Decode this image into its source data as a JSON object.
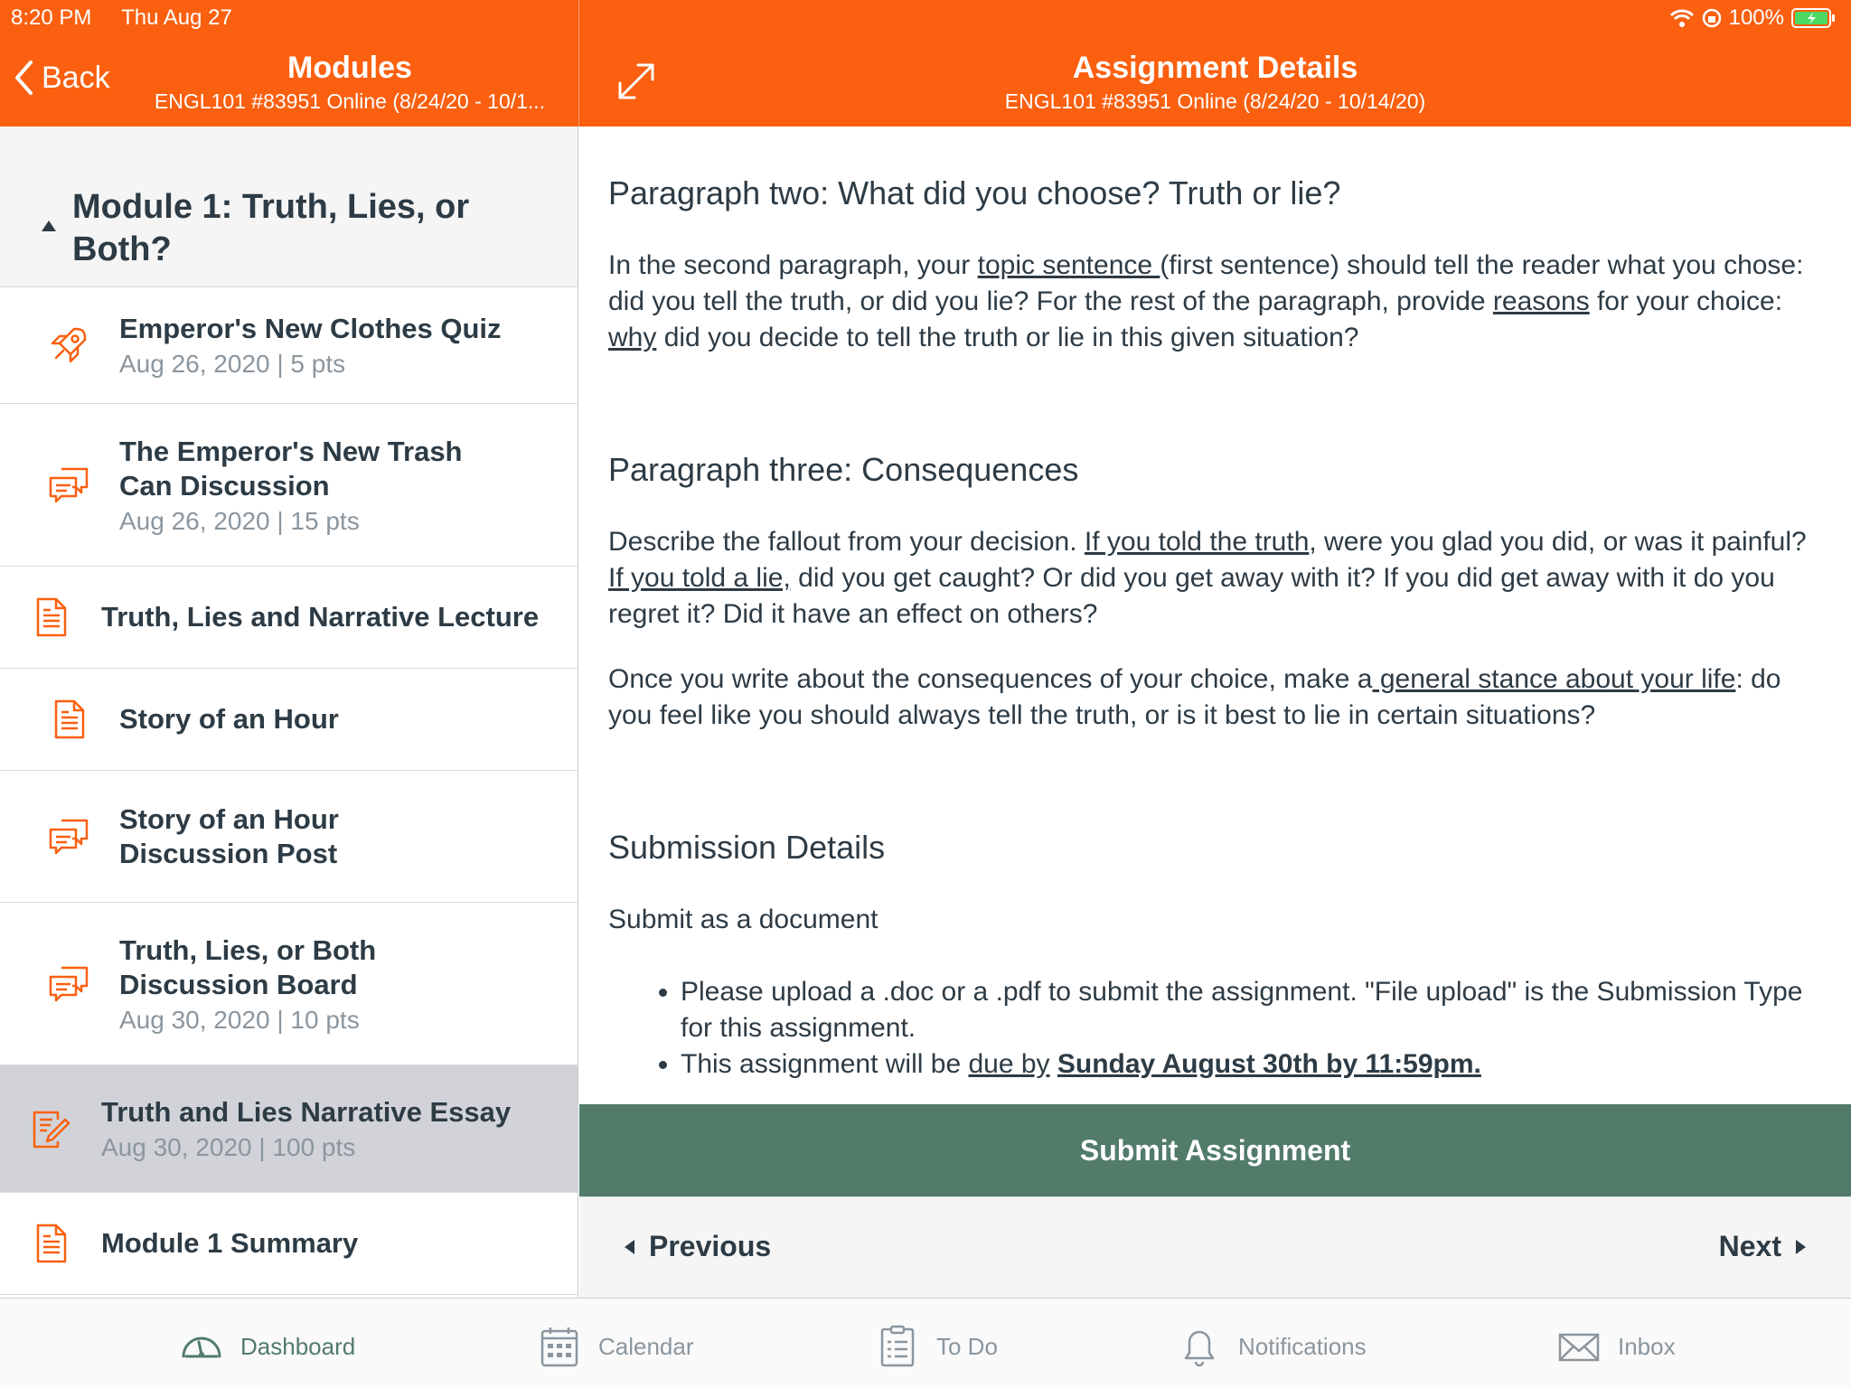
{
  "status_bar": {
    "time": "8:20 PM",
    "date": "Thu Aug 27",
    "battery": "100%"
  },
  "left_header": {
    "back_label": "Back",
    "title": "Modules",
    "subtitle": "ENGL101 #83951 Online (8/24/20 - 10/1..."
  },
  "right_header": {
    "title": "Assignment Details",
    "subtitle": "ENGL101 #83951 Online (8/24/20 - 10/14/20)"
  },
  "module": {
    "name": "Module 1: Truth, Lies, or Both?",
    "items": [
      {
        "icon": "rocket-icon",
        "title": "Emperor's New Clothes Quiz",
        "meta": "Aug 26, 2020 | 5 pts"
      },
      {
        "icon": "discussion-icon",
        "title": "The Emperor's New Trash Can Discussion",
        "meta": "Aug 26, 2020 | 15 pts"
      },
      {
        "icon": "page-icon",
        "title": "Truth, Lies and Narrative Lecture",
        "meta": ""
      },
      {
        "icon": "page-icon",
        "title": "Story of an Hour",
        "meta": ""
      },
      {
        "icon": "discussion-icon",
        "title": "Story of an Hour Discussion Post",
        "meta": ""
      },
      {
        "icon": "discussion-icon",
        "title": "Truth, Lies, or Both Discussion Board",
        "meta": "Aug 30, 2020 | 10 pts"
      },
      {
        "icon": "assignment-icon",
        "title": "Truth and Lies Narrative Essay",
        "meta": "Aug 30, 2020 | 100 pts",
        "selected": true
      },
      {
        "icon": "page-icon",
        "title": "Module 1 Summary",
        "meta": ""
      }
    ]
  },
  "content": {
    "p2_heading": "Paragraph two: What did you choose? Truth or lie?",
    "p2_a": "In the second paragraph, your ",
    "p2_link1": "topic sentence ",
    "p2_b": "(first sentence) should tell the reader what you chose: did you tell the truth, or did you lie? For the rest of the paragraph, provide ",
    "p2_link2": "reasons",
    "p2_c": " for your choice: ",
    "p2_link3": "why",
    "p2_d": " did you decide to tell the truth or lie in this given situation?",
    "p3_heading": "Paragraph three: Consequences",
    "p3_a": "Describe the fallout from your decision. ",
    "p3_link1": "If you told the truth",
    "p3_b": ", were you glad you did, or was it painful? ",
    "p3_link2": "If you told a lie,",
    "p3_c": " did you get caught? Or did you get away with it? If you did get away with it do you regret it? Did it have an effect on others?",
    "p4_a": "Once you write about the consequences of your choice, make a",
    "p4_link1": " general stance about your life",
    "p4_b": ": do you feel like you should always tell the truth, or is it best to lie in certain situations?",
    "sub_heading": "Submission Details",
    "sub_text": "Submit as a document",
    "bullet1": "Please upload a .doc or a .pdf to submit the assignment. \"File upload\" is the Submission Type for this assignment.",
    "bullet2_a": "This assignment will be ",
    "bullet2_link": "due by",
    "bullet2_b": " ",
    "bullet2_bold": "Sunday August 30th by 11:59pm."
  },
  "actions": {
    "submit_label": "Submit Assignment",
    "previous_label": "Previous",
    "next_label": "Next"
  },
  "tabs": [
    {
      "label": "Dashboard",
      "icon": "dashboard-icon",
      "active": true
    },
    {
      "label": "Calendar",
      "icon": "calendar-icon"
    },
    {
      "label": "To Do",
      "icon": "todo-icon"
    },
    {
      "label": "Notifications",
      "icon": "bell-icon"
    },
    {
      "label": "Inbox",
      "icon": "inbox-icon"
    }
  ],
  "colors": {
    "brand": "#fa6010",
    "submit": "#527b6a",
    "text": "#2d3b45",
    "muted": "#8b969e",
    "selected_row": "#d1d3d9"
  }
}
